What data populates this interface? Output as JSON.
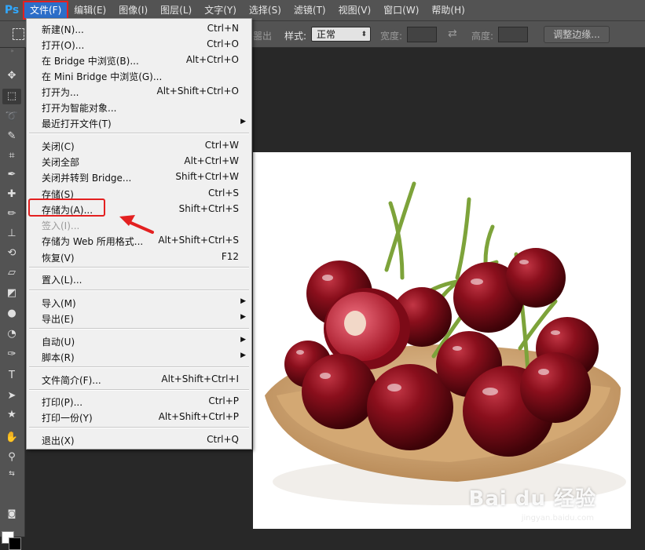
{
  "app": {
    "logo": "Ps"
  },
  "menubar": {
    "items": [
      "文件(F)",
      "编辑(E)",
      "图像(I)",
      "图层(L)",
      "文字(Y)",
      "选择(S)",
      "滤镜(T)",
      "视图(V)",
      "窗口(W)",
      "帮助(H)"
    ]
  },
  "options": {
    "partial_text": "噐出",
    "style_label": "样式:",
    "style_value": "正常",
    "width_label": "宽度:",
    "height_label": "高度:",
    "refine_edge": "调整边缘..."
  },
  "file_menu": {
    "items": [
      {
        "label": "新建(N)...",
        "shortcut": "Ctrl+N"
      },
      {
        "label": "打开(O)...",
        "shortcut": "Ctrl+O"
      },
      {
        "label": "在 Bridge 中浏览(B)...",
        "shortcut": "Alt+Ctrl+O"
      },
      {
        "label": "在 Mini Bridge 中浏览(G)...",
        "shortcut": ""
      },
      {
        "label": "打开为...",
        "shortcut": "Alt+Shift+Ctrl+O"
      },
      {
        "label": "打开为智能对象...",
        "shortcut": ""
      },
      {
        "label": "最近打开文件(T)",
        "shortcut": ""
      },
      {
        "label": "关闭(C)",
        "shortcut": "Ctrl+W"
      },
      {
        "label": "关闭全部",
        "shortcut": "Alt+Ctrl+W"
      },
      {
        "label": "关闭并转到 Bridge...",
        "shortcut": "Shift+Ctrl+W"
      },
      {
        "label": "存储(S)",
        "shortcut": "Ctrl+S"
      },
      {
        "label": "存储为(A)...",
        "shortcut": "Shift+Ctrl+S"
      },
      {
        "label": "签入(I)...",
        "shortcut": ""
      },
      {
        "label": "存储为 Web 所用格式...",
        "shortcut": "Alt+Shift+Ctrl+S"
      },
      {
        "label": "恢复(V)",
        "shortcut": "F12"
      },
      {
        "label": "置入(L)...",
        "shortcut": ""
      },
      {
        "label": "导入(M)",
        "shortcut": ""
      },
      {
        "label": "导出(E)",
        "shortcut": ""
      },
      {
        "label": "自动(U)",
        "shortcut": ""
      },
      {
        "label": "脚本(R)",
        "shortcut": ""
      },
      {
        "label": "文件简介(F)...",
        "shortcut": "Alt+Shift+Ctrl+I"
      },
      {
        "label": "打印(P)...",
        "shortcut": "Ctrl+P"
      },
      {
        "label": "打印一份(Y)",
        "shortcut": "Alt+Shift+Ctrl+P"
      },
      {
        "label": "退出(X)",
        "shortcut": "Ctrl+Q"
      }
    ]
  },
  "watermark": {
    "brand": "Bai du 经验",
    "url": "jingyan.baidu.com"
  },
  "colors": {
    "menu_bg": "#f0f0f0",
    "highlight": "#e32020",
    "ui_dark": "#535353",
    "canvas_bg": "#282828"
  }
}
